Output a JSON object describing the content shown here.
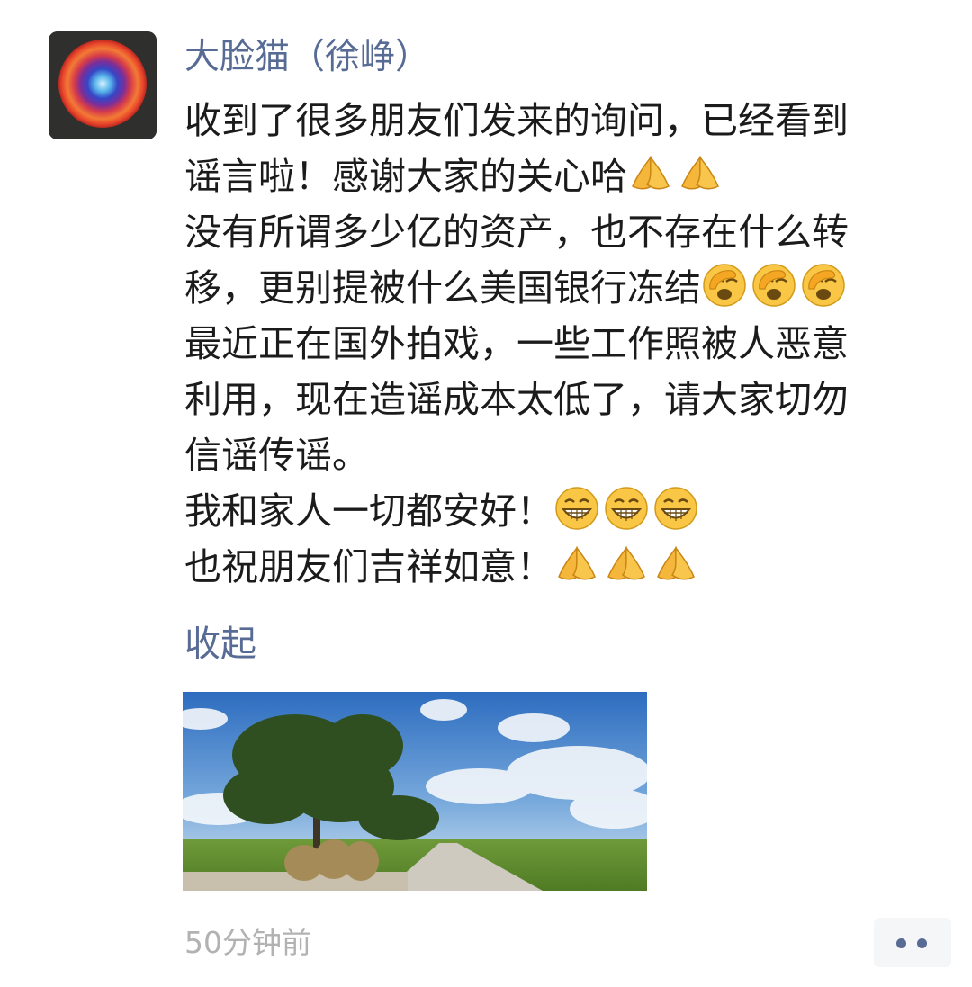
{
  "post": {
    "author_name": "大脸猫（徐峥）",
    "text_lines": [
      {
        "text": "收到了很多朋友们发来的询问，已经看到",
        "emojis": []
      },
      {
        "text": "谣言啦！感谢大家的关心哈",
        "emojis": [
          "pray-emoji",
          "pray-emoji"
        ]
      },
      {
        "text": "没有所谓多少亿的资产，也不存在什么转",
        "emojis": []
      },
      {
        "text": "移，更别提被什么美国银行冻结",
        "emojis": [
          "facepalm-emoji",
          "facepalm-emoji",
          "facepalm-emoji"
        ]
      },
      {
        "text": "最近正在国外拍戏，一些工作照被人恶意",
        "emojis": []
      },
      {
        "text": "利用，现在造谣成本太低了，请大家切勿",
        "emojis": []
      },
      {
        "text": "信谣传谣。",
        "emojis": []
      },
      {
        "text": "我和家人一切都安好！",
        "emojis": [
          "grin-emoji",
          "grin-emoji",
          "grin-emoji"
        ]
      },
      {
        "text": "也祝朋友们吉祥如意！",
        "emojis": [
          "pray-emoji",
          "pray-emoji",
          "pray-emoji"
        ]
      }
    ],
    "collapse_label": "收起",
    "timestamp": "50分钟前",
    "more_icon": "more-dots-icon"
  },
  "colors": {
    "link": "#576b95",
    "text": "#1b1b1b",
    "meta": "#b2b2b2",
    "more_button_bg": "#f5f6f7"
  }
}
